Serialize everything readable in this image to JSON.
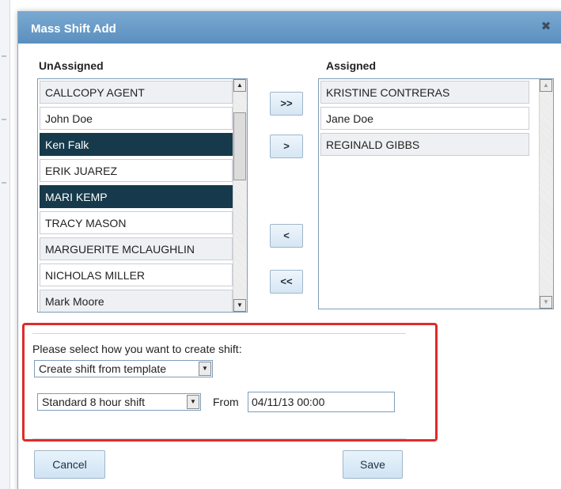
{
  "dialog": {
    "title": "Mass Shift Add",
    "close_icon": "close-icon"
  },
  "unassigned": {
    "label": "UnAssigned",
    "items": [
      {
        "name": "CALLCOPY AGENT",
        "selected": false
      },
      {
        "name": "John Doe",
        "selected": false
      },
      {
        "name": "Ken Falk",
        "selected": true
      },
      {
        "name": "ERIK JUAREZ",
        "selected": false
      },
      {
        "name": "MARI KEMP",
        "selected": true
      },
      {
        "name": "TRACY MASON",
        "selected": false
      },
      {
        "name": "MARGUERITE MCLAUGHLIN",
        "selected": false
      },
      {
        "name": "NICHOLAS MILLER",
        "selected": false
      },
      {
        "name": "Mark Moore",
        "selected": false
      }
    ]
  },
  "assigned": {
    "label": "Assigned",
    "items": [
      {
        "name": "KRISTINE CONTRERAS"
      },
      {
        "name": "Jane Doe"
      },
      {
        "name": "REGINALD GIBBS"
      }
    ]
  },
  "move_buttons": {
    "add_all": ">>",
    "add_selected": ">",
    "remove_selected": "<",
    "remove_all": "<<"
  },
  "shift_creation": {
    "prompt": "Please select how you want to create shift:",
    "method_select": "Create shift from template",
    "template_select": "Standard 8 hour shift",
    "from_label": "From",
    "from_value": "04/11/13 00:00"
  },
  "footer": {
    "cancel_label": "Cancel",
    "save_label": "Save"
  },
  "colors": {
    "titlebar": "#5b8fbf",
    "selected_row": "#163a4c",
    "highlight_border": "#e02a2a"
  }
}
